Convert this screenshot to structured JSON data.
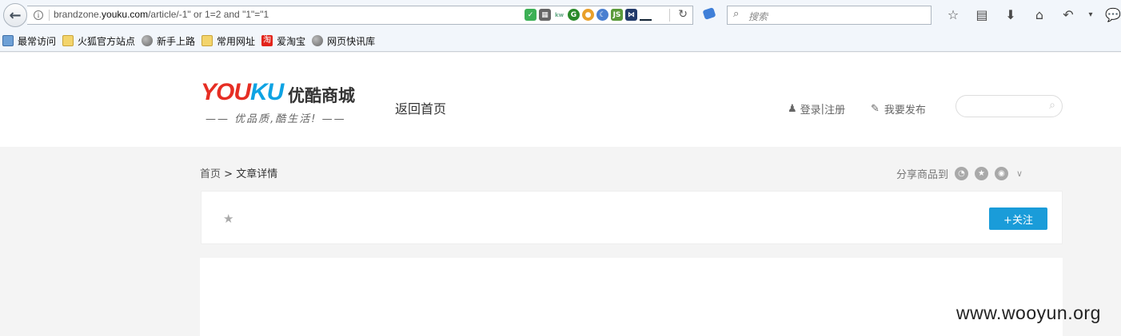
{
  "browser": {
    "url_prefix": "brandzone.",
    "url_host": "youku.com",
    "url_path": "/article/-1\" or 1=2 and \"1\"=\"1",
    "search_placeholder": "搜索"
  },
  "bookmarks": [
    {
      "label": "最常访问",
      "icon": "recent-icon"
    },
    {
      "label": "火狐官方站点",
      "icon": "folder-icon"
    },
    {
      "label": "新手上路",
      "icon": "globe-icon"
    },
    {
      "label": "常用网址",
      "icon": "folder-icon"
    },
    {
      "label": "爱淘宝",
      "icon": "taobao-icon",
      "glyph": "淘"
    },
    {
      "label": "网页快讯库",
      "icon": "globe-icon"
    }
  ],
  "header": {
    "logo_y": "YOU",
    "logo_ku": "KU",
    "logo_cn": "优酷商城",
    "slogan": "—— 优品质,酷生活! ——",
    "back_home": "返回首页",
    "login": "登录",
    "login_sep": " | ",
    "register": "注册",
    "publish": "我要发布"
  },
  "breadcrumb": {
    "home": "首页",
    "sep": " > ",
    "current": "文章详情"
  },
  "share": {
    "label": "分享商品到"
  },
  "card": {
    "follow_label": "+关注"
  },
  "watermark": "www.wooyun.org"
}
